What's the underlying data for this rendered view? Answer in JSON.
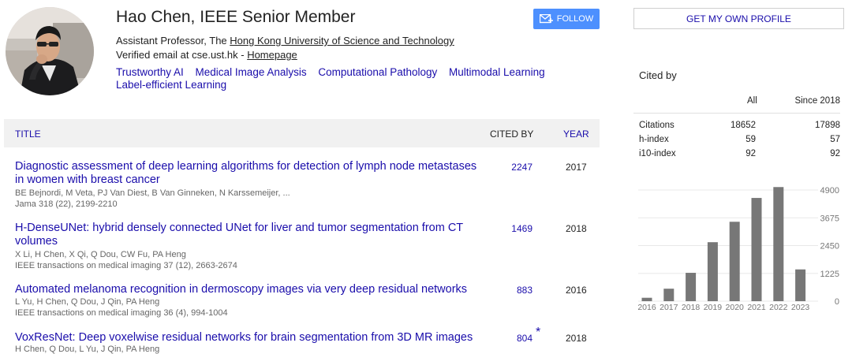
{
  "profile": {
    "name": "Hao Chen, IEEE Senior Member",
    "affiliation_prefix": "Assistant Professor, The ",
    "affiliation_link": "Hong Kong University of Science and Technology",
    "email_prefix": "Verified email at cse.ust.hk - ",
    "homepage_label": "Homepage",
    "interests": [
      "Trustworthy AI",
      "Medical Image Analysis",
      "Computational Pathology",
      "Multimodal Learning",
      "Label-efficient Learning"
    ],
    "follow_label": "FOLLOW"
  },
  "sidebar": {
    "get_profile_label": "GET MY OWN PROFILE",
    "cited_by_title": "Cited by",
    "col_all": "All",
    "col_since": "Since 2018",
    "metrics": [
      {
        "label": "Citations",
        "all": "18652",
        "since": "17898"
      },
      {
        "label": "h-index",
        "all": "59",
        "since": "57"
      },
      {
        "label": "i10-index",
        "all": "92",
        "since": "92"
      }
    ]
  },
  "table": {
    "col_title": "TITLE",
    "col_cited": "CITED BY",
    "col_year": "YEAR",
    "rows": [
      {
        "title": "Diagnostic assessment of deep learning algorithms for detection of lymph node metastases in women with breast cancer",
        "authors": "BE Bejnordi, M Veta, PJ Van Diest, B Van Ginneken, N Karssemeijer, ...",
        "venue": "Jama 318 (22), 2199-2210",
        "cited": "2247",
        "year": "2017"
      },
      {
        "title": "H-DenseUNet: hybrid densely connected UNet for liver and tumor segmentation from CT volumes",
        "authors": "X Li, H Chen, X Qi, Q Dou, CW Fu, PA Heng",
        "venue": "IEEE transactions on medical imaging 37 (12), 2663-2674",
        "cited": "1469",
        "year": "2018"
      },
      {
        "title": "Automated melanoma recognition in dermoscopy images via very deep residual networks",
        "authors": "L Yu, H Chen, Q Dou, J Qin, PA Heng",
        "venue": "IEEE transactions on medical imaging 36 (4), 994-1004",
        "cited": "883",
        "year": "2016"
      },
      {
        "title": "VoxResNet: Deep voxelwise residual networks for brain segmentation from 3D MR images",
        "authors": "H Chen, Q Dou, L Yu, J Qin, PA Heng",
        "venue": "",
        "cited": "804",
        "star": "*",
        "year": "2018"
      }
    ]
  },
  "chart_data": {
    "type": "bar",
    "categories": [
      "2016",
      "2017",
      "2018",
      "2019",
      "2020",
      "2021",
      "2022",
      "2023"
    ],
    "values": [
      150,
      550,
      1250,
      2600,
      3500,
      4550,
      5030,
      1400
    ],
    "yticks": [
      "4900",
      "3675",
      "2450",
      "1225",
      "0"
    ],
    "ylim": [
      0,
      4900
    ],
    "bar_color": "#777777",
    "grid": true
  }
}
